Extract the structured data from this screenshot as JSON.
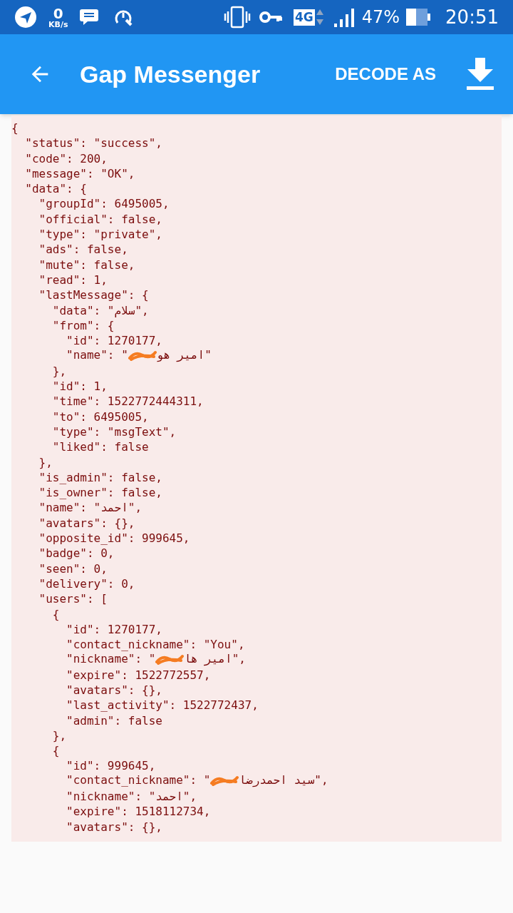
{
  "status_bar": {
    "speed_value": "0",
    "speed_unit": "KB/s",
    "network": "4G",
    "battery": "47%",
    "time": "20:51"
  },
  "app_bar": {
    "title": "Gap Messenger",
    "action": "DECODE AS"
  },
  "code_lines": [
    {
      "kind": "plain",
      "text": "{"
    },
    {
      "kind": "plain",
      "text": "  \"status\": \"success\","
    },
    {
      "kind": "plain",
      "text": "  \"code\": 200,"
    },
    {
      "kind": "plain",
      "text": "  \"message\": \"OK\","
    },
    {
      "kind": "plain",
      "text": "  \"data\": {"
    },
    {
      "kind": "plain",
      "text": "    \"groupId\": 6495005,"
    },
    {
      "kind": "plain",
      "text": "    \"official\": false,"
    },
    {
      "kind": "plain",
      "text": "    \"type\": \"private\","
    },
    {
      "kind": "plain",
      "text": "    \"ads\": false,"
    },
    {
      "kind": "plain",
      "text": "    \"mute\": false,"
    },
    {
      "kind": "plain",
      "text": "    \"read\": 1,"
    },
    {
      "kind": "plain",
      "text": "    \"lastMessage\": {"
    },
    {
      "kind": "plain",
      "text": "      \"data\": \"سلام\","
    },
    {
      "kind": "plain",
      "text": "      \"from\": {"
    },
    {
      "kind": "plain",
      "text": "        \"id\": 1270177,"
    },
    {
      "kind": "redacted",
      "before": "        \"name\": \"",
      "after": "امیر هو\""
    },
    {
      "kind": "plain",
      "text": "      },"
    },
    {
      "kind": "plain",
      "text": "      \"id\": 1,"
    },
    {
      "kind": "plain",
      "text": "      \"time\": 1522772444311,"
    },
    {
      "kind": "plain",
      "text": "      \"to\": 6495005,"
    },
    {
      "kind": "plain",
      "text": "      \"type\": \"msgText\","
    },
    {
      "kind": "plain",
      "text": "      \"liked\": false"
    },
    {
      "kind": "plain",
      "text": "    },"
    },
    {
      "kind": "plain",
      "text": "    \"is_admin\": false,"
    },
    {
      "kind": "plain",
      "text": "    \"is_owner\": false,"
    },
    {
      "kind": "plain",
      "text": "    \"name\": \"احمد\","
    },
    {
      "kind": "plain",
      "text": "    \"avatars\": {},"
    },
    {
      "kind": "plain",
      "text": "    \"opposite_id\": 999645,"
    },
    {
      "kind": "plain",
      "text": "    \"badge\": 0,"
    },
    {
      "kind": "plain",
      "text": "    \"seen\": 0,"
    },
    {
      "kind": "plain",
      "text": "    \"delivery\": 0,"
    },
    {
      "kind": "plain",
      "text": "    \"users\": ["
    },
    {
      "kind": "plain",
      "text": "      {"
    },
    {
      "kind": "plain",
      "text": "        \"id\": 1270177,"
    },
    {
      "kind": "plain",
      "text": "        \"contact_nickname\": \"You\","
    },
    {
      "kind": "redacted",
      "before": "        \"nickname\": \"",
      "after": "امیر ها\","
    },
    {
      "kind": "plain",
      "text": "        \"expire\": 1522772557,"
    },
    {
      "kind": "plain",
      "text": "        \"avatars\": {},"
    },
    {
      "kind": "plain",
      "text": "        \"last_activity\": 1522772437,"
    },
    {
      "kind": "plain",
      "text": "        \"admin\": false"
    },
    {
      "kind": "plain",
      "text": "      },"
    },
    {
      "kind": "plain",
      "text": "      {"
    },
    {
      "kind": "plain",
      "text": "        \"id\": 999645,"
    },
    {
      "kind": "redacted",
      "before": "        \"contact_nickname\": \"",
      "after": "سید احمدرضا\","
    },
    {
      "kind": "plain",
      "text": "        \"nickname\": \"احمد\","
    },
    {
      "kind": "plain",
      "text": "        \"expire\": 1518112734,"
    },
    {
      "kind": "plain",
      "text": "        \"avatars\": {},"
    }
  ]
}
